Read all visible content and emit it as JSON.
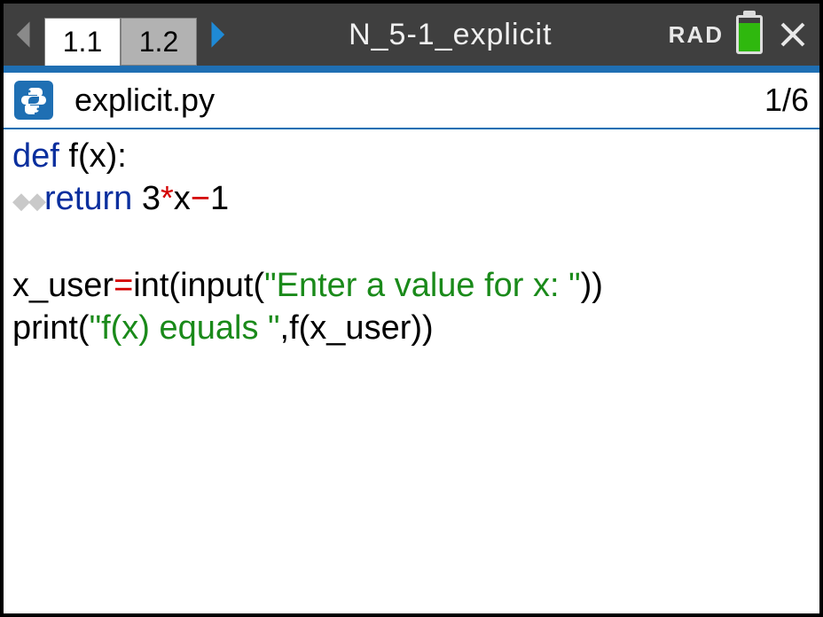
{
  "header": {
    "tabs": [
      {
        "label": "1.1",
        "active": true
      },
      {
        "label": "1.2",
        "active": false
      }
    ],
    "title": "N_5-1_explicit",
    "angle_mode": "RAD"
  },
  "file": {
    "name": "explicit.py",
    "line_indicator": "1/6"
  },
  "code": {
    "kw_def": "def",
    "fn": "f",
    "param": "x",
    "colon": ":",
    "kw_return": "return",
    "three": "3",
    "star": "*",
    "x2": "x",
    "minus": "−",
    "one": "1",
    "var_xuser": "x_user",
    "eq": "=",
    "int_fn": "int",
    "input_fn": "input",
    "prompt_str": "\"Enter a value for x: \"",
    "print_fn": "print",
    "out_str": "\"f(x) equals \"",
    "comma": ",",
    "call_f": "f",
    "arg_xuser": "x_user"
  }
}
